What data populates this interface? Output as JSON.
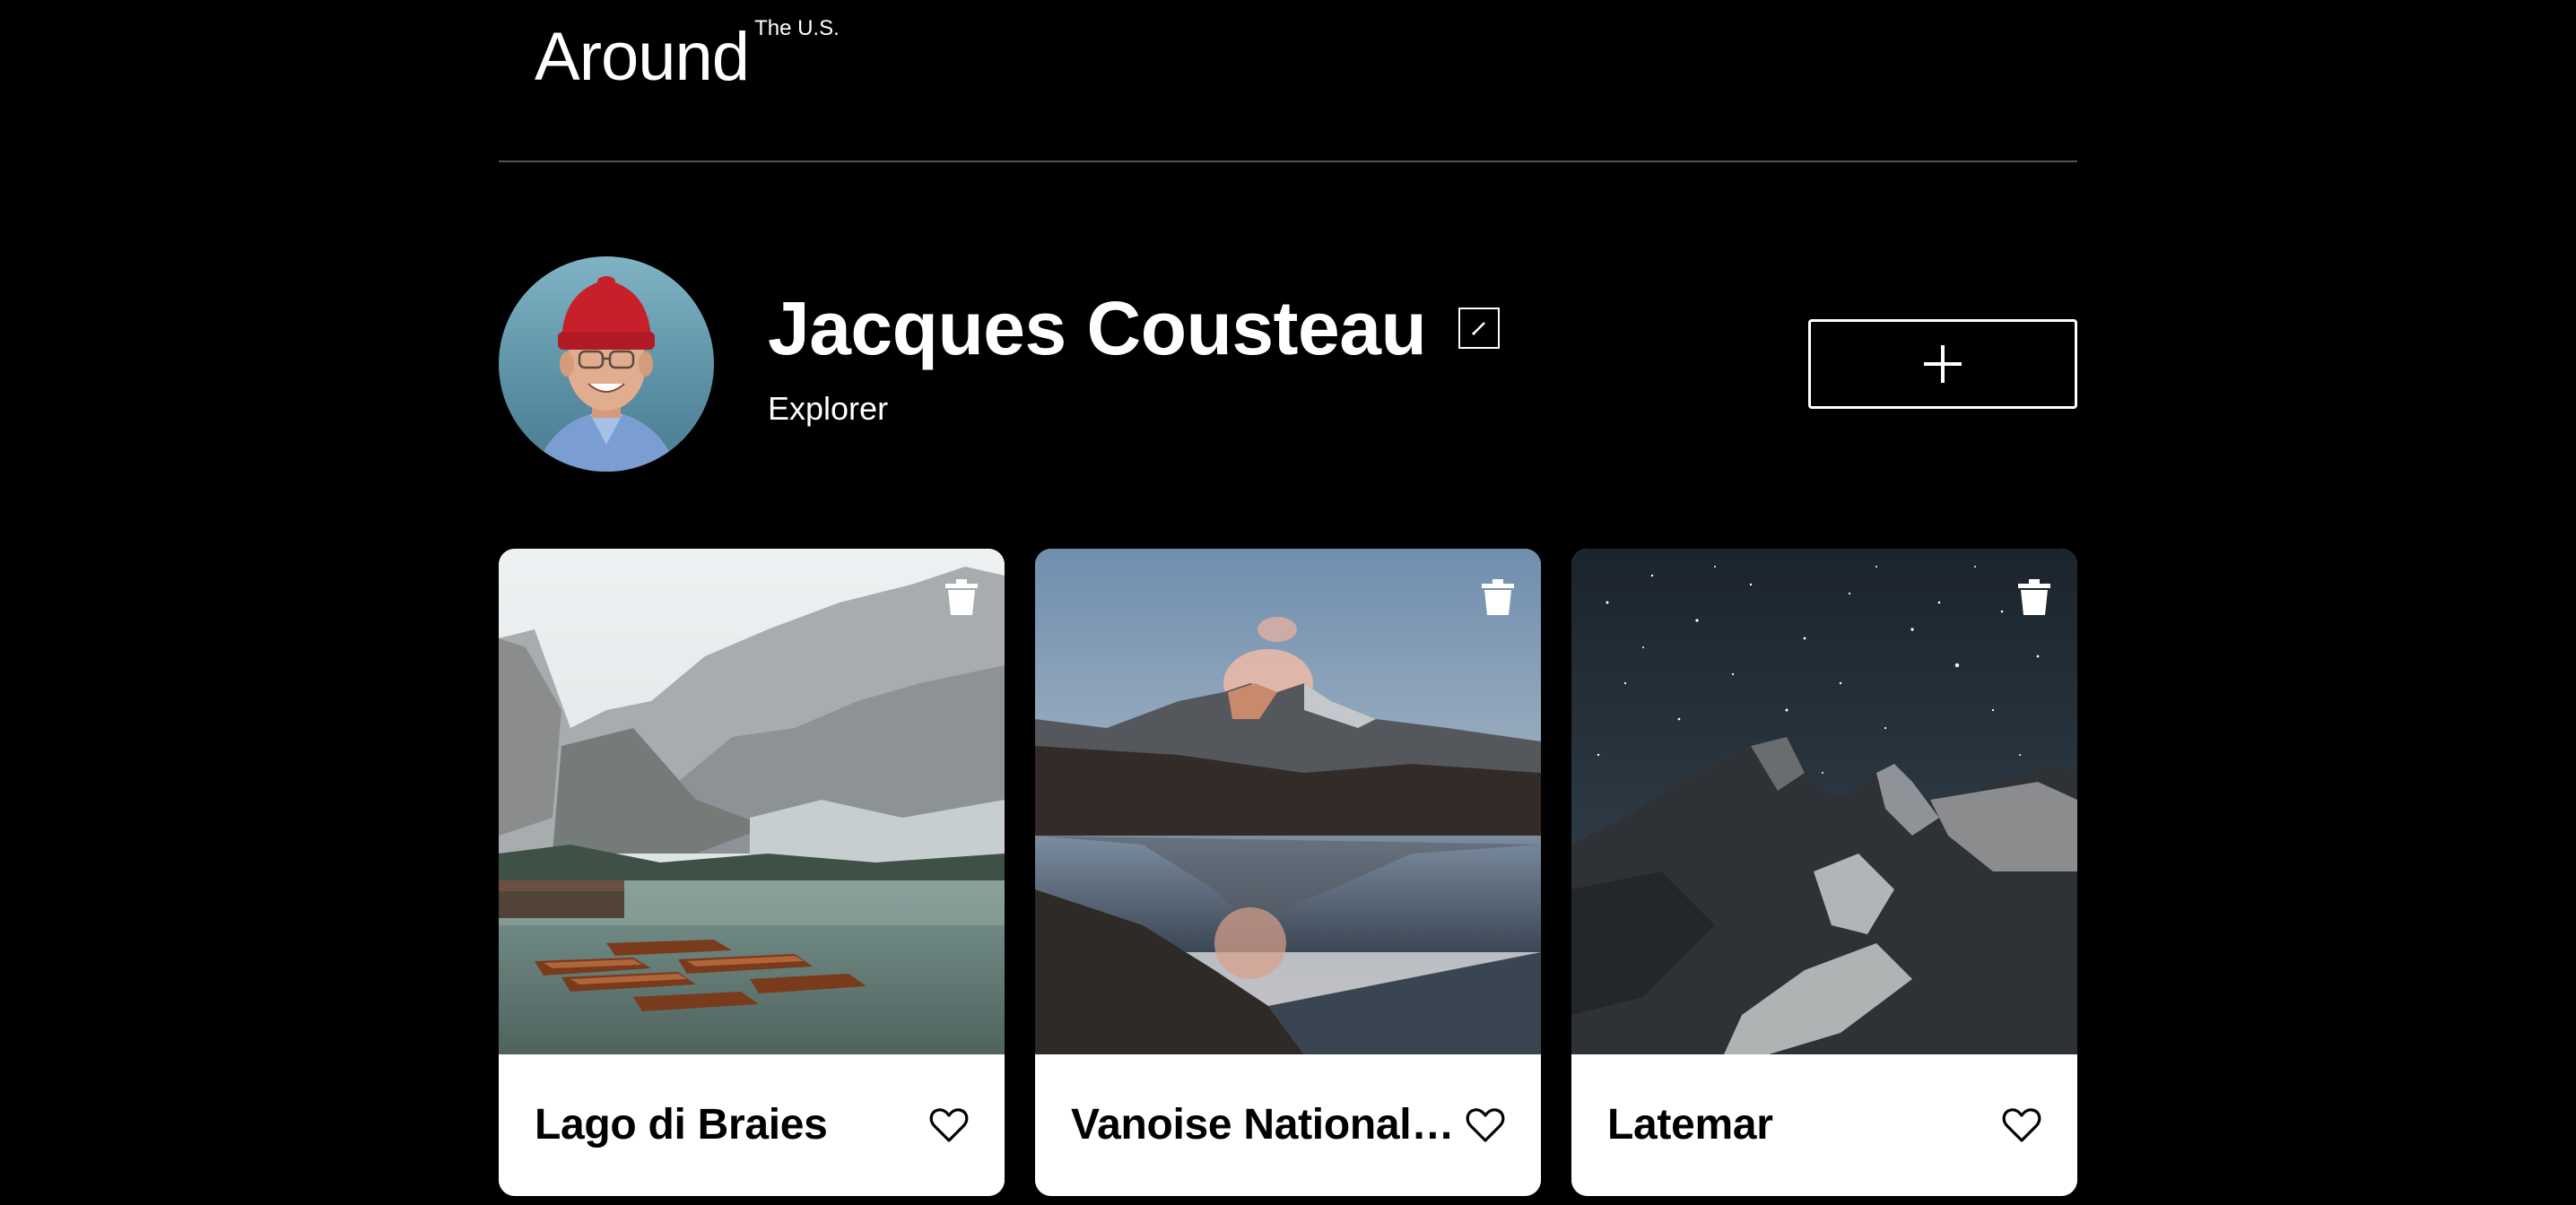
{
  "header": {
    "logo_main": "Around",
    "logo_sup": "The U.S."
  },
  "profile": {
    "name": "Jacques Cousteau",
    "job": "Explorer",
    "avatar_icon": "avatar-photo",
    "edit_icon": "pencil-icon",
    "add_icon": "plus-icon"
  },
  "cards": [
    {
      "title": "Lago di Braies",
      "liked": false
    },
    {
      "title": "Vanoise National Park",
      "liked": false
    },
    {
      "title": "Latemar",
      "liked": false
    }
  ],
  "colors": {
    "background": "#000000",
    "divider": "#545454",
    "card_footer": "#ffffff",
    "avatar_hat": "#c8202a"
  }
}
